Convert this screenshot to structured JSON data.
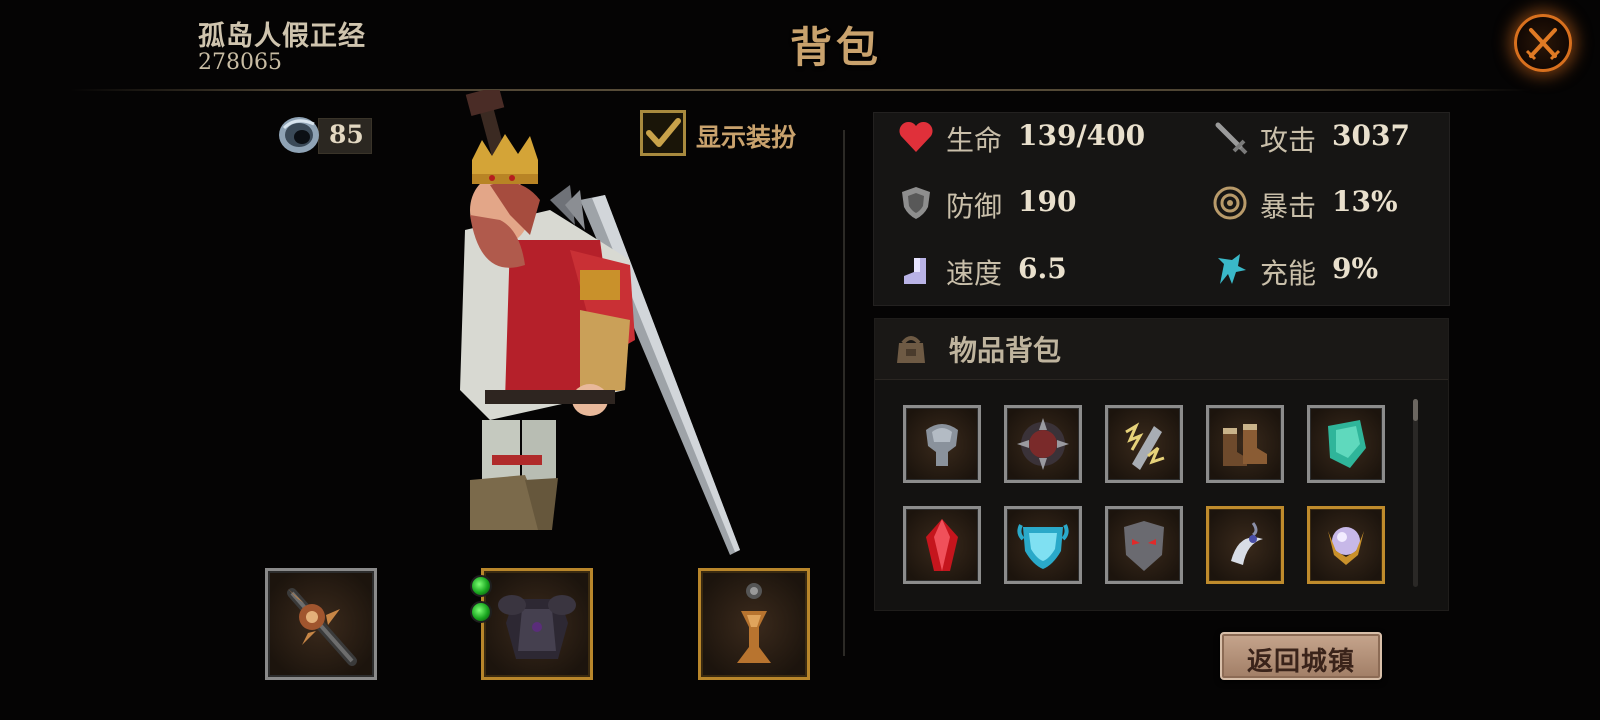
{
  "header": {
    "player_name": "孤岛人假正经",
    "player_id": "278065",
    "title": "背包"
  },
  "currency": {
    "value": "85",
    "icon": "gem-ring-icon"
  },
  "outfit_toggle": {
    "label": "显示装扮",
    "checked": true
  },
  "stats": [
    {
      "id": "hp",
      "icon": "heart-icon",
      "label": "生命",
      "value": "139/400",
      "color": "#e0303a"
    },
    {
      "id": "attack",
      "icon": "sword-icon",
      "label": "攻击",
      "value": "3037",
      "color": "#9a9a9a"
    },
    {
      "id": "defense",
      "icon": "shield-icon",
      "label": "防御",
      "value": "190",
      "color": "#9a9a9a"
    },
    {
      "id": "crit",
      "icon": "crit-target-icon",
      "label": "暴击",
      "value": "13%",
      "color": "#b89a6a"
    },
    {
      "id": "speed",
      "icon": "boot-icon",
      "label": "速度",
      "value": "6.5",
      "color": "#b9b3e6"
    },
    {
      "id": "charge",
      "icon": "energy-claw-icon",
      "label": "充能",
      "value": "9%",
      "color": "#3ab8c8"
    }
  ],
  "inventory": {
    "title": "物品背包",
    "items": [
      {
        "name": "steel-helmet-item",
        "frame": "silver"
      },
      {
        "name": "spiked-shield-item",
        "frame": "silver"
      },
      {
        "name": "lightning-bracer-item",
        "frame": "silver"
      },
      {
        "name": "leather-boots-item",
        "frame": "silver"
      },
      {
        "name": "jade-armor-shard-item",
        "frame": "silver"
      },
      {
        "name": "red-crystal-item",
        "frame": "silver"
      },
      {
        "name": "crystal-shield-item",
        "frame": "silver"
      },
      {
        "name": "demon-mask-item",
        "frame": "silver"
      },
      {
        "name": "moon-amulet-item",
        "frame": "gold"
      },
      {
        "name": "orb-claw-item",
        "frame": "gold"
      }
    ]
  },
  "equipment": [
    {
      "name": "spiked-mace-equip",
      "frame": "silver"
    },
    {
      "name": "dark-armor-equip",
      "frame": "gold",
      "gems": 2
    },
    {
      "name": "pendant-equip",
      "frame": "gold"
    }
  ],
  "return_button": {
    "label": "返回城镇"
  }
}
